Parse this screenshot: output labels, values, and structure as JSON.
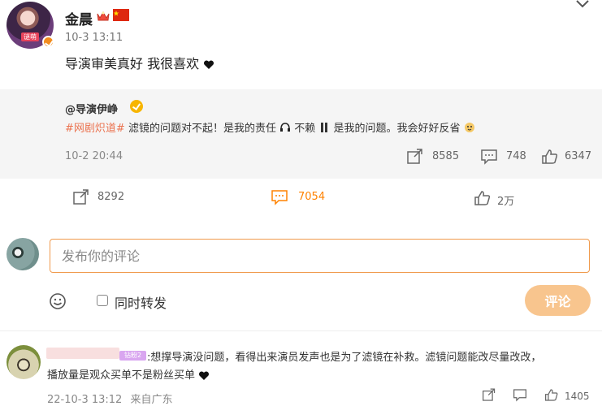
{
  "post": {
    "username": "金晨",
    "time": "10-3 13:11",
    "text": "导演审美真好  我很喜欢",
    "avatar_label": "谜萌",
    "stats": {
      "repost": "8292",
      "comment": "7054",
      "like": "2万"
    }
  },
  "retweet": {
    "username": "@导演伊峥",
    "hashtag": "#网剧炽道#",
    "text_part1": " 滤镜的问题对不起！是我的责任",
    "text_part2": "不赖",
    "text_part3": " 是我的问题。我会好好反省",
    "time": "10-2 20:44",
    "stats": {
      "repost": "8585",
      "comment": "748",
      "like": "6347"
    }
  },
  "compose": {
    "placeholder": "发布你的评论",
    "sync_label": "同时转发",
    "submit_label": "评论"
  },
  "comment": {
    "fan_badge": "钻粉2",
    "text_line1": ":想撑导演没问题，看得出来演员发声也是为了滤镜在补救。滤镜问题能改尽量改改，",
    "text_line2": "播放量是观众买单不是粉丝买单",
    "time": "22-10-3 13:12",
    "location": "来自广东",
    "like_count": "1405"
  },
  "colors": {
    "accent": "#ff8200",
    "hashtag": "#eb7350",
    "button_disabled": "#f8c58e"
  },
  "icons": [
    "chevron-down-icon",
    "crown-icon",
    "china-flag-icon",
    "verified-badge-icon",
    "repost-icon",
    "comment-icon",
    "like-icon",
    "emoji-icon",
    "heart-icon"
  ]
}
